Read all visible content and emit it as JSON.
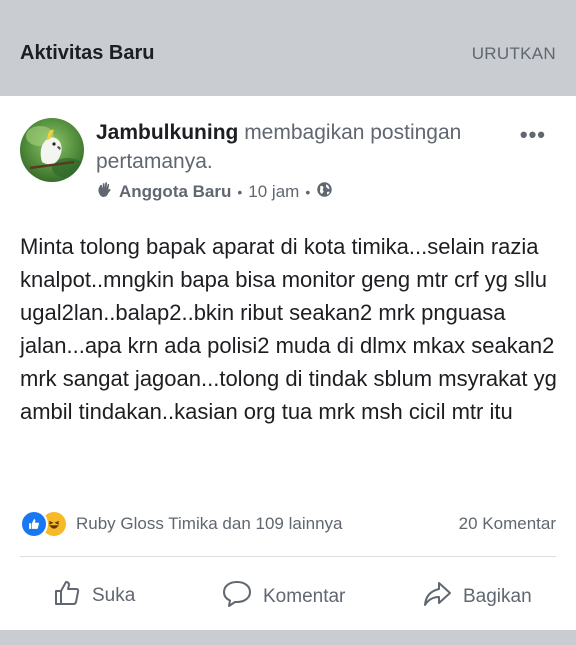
{
  "header": {
    "title": "Aktivitas Baru",
    "sort_label": "URUTKAN"
  },
  "post": {
    "author": "Jambulkuning",
    "action_text": " membagikan postingan pertamanya.",
    "badge_icon": "waving-hand-icon",
    "badge": "Anggota Baru",
    "time": "10 jam",
    "privacy_icon": "globe-icon",
    "more_label": "•••",
    "text": "Minta tolong bapak aparat di kota timika...selain razia knalpot..mngkin bapa bisa monitor geng mtr crf yg sllu ugal2lan..balap2..bkin ribut seakan2 mrk pnguasa jalan...apa krn ada polisi2 muda di dlmx mkax seakan2 mrk sangat jagoan...tolong di tindak sblum msyrakat yg ambil tindakan..kasian org tua mrk msh cicil mtr itu"
  },
  "reactions": {
    "icons": [
      "like-reaction-icon",
      "haha-reaction-icon"
    ],
    "summary": "Ruby Gloss Timika dan 109 lainnya",
    "comments": "20 Komentar"
  },
  "actions": {
    "like": "Suka",
    "comment": "Komentar",
    "share": "Bagikan"
  },
  "colors": {
    "background": "#c9ccd1",
    "card": "#ffffff",
    "text_primary": "#1c1e21",
    "text_secondary": "#606770",
    "like_blue": "#1877f2",
    "haha_yellow": "#f7b928"
  }
}
